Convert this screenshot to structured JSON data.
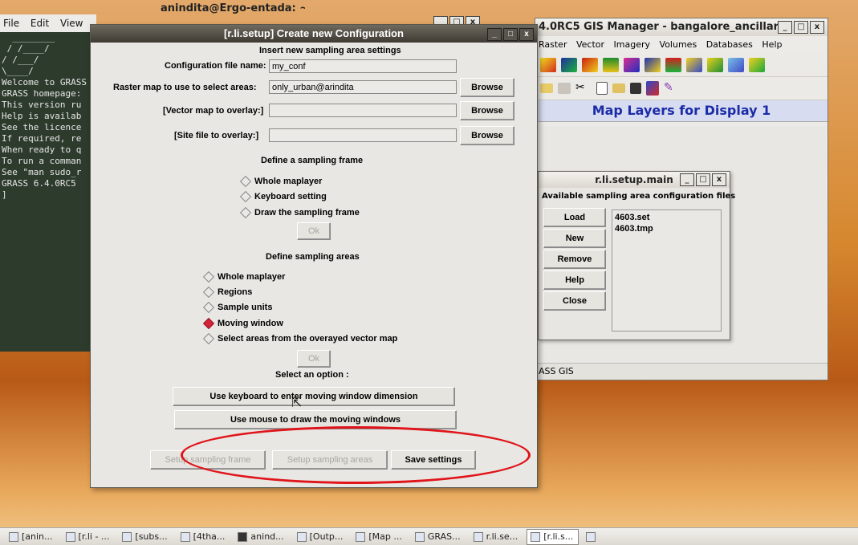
{
  "terminal": {
    "title": "anindita@Ergo-entada: ~",
    "menu": [
      "File",
      "Edit",
      "View"
    ],
    "lines": [
      "  ________",
      " / /____/",
      "/ /___/",
      "\\____/",
      "",
      "Welcome to GRASS",
      "GRASS homepage:",
      "This version ru",
      "Help is availab",
      "See the licence",
      "If required, re",
      "When ready to q",
      "",
      "To run a comman",
      "See \"man sudo_r",
      "",
      "GRASS 6.4.0RC5",
      "]"
    ]
  },
  "gis": {
    "title": "4.0RC5 GIS Manager - bangalore_ancillar",
    "menu": [
      "Raster",
      "Vector",
      "Imagery",
      "Volumes",
      "Databases",
      "Help"
    ],
    "map_layers": "Map Layers for Display 1",
    "status": "ASS GIS"
  },
  "setup_main": {
    "title": "r.li.setup.main",
    "header": "Available sampling area configuration files",
    "buttons": [
      "Load",
      "New",
      "Remove",
      "Help",
      "Close"
    ],
    "files": [
      "4603.set",
      "4603.tmp"
    ]
  },
  "dialog": {
    "title": "[r.li.setup] Create new Configuration",
    "section_title": "Insert new sampling area settings",
    "config_label": "Configuration file name:",
    "config_value": "my_conf",
    "raster_label": "Raster map to use to select areas:",
    "raster_value": "only_urban@arindita",
    "vector_label": "[Vector map to overlay:]",
    "site_label": "[Site file to overlay:]",
    "browse": "Browse",
    "frame_title": "Define a sampling frame",
    "frame_options": [
      "Whole maplayer",
      "Keyboard setting",
      "Draw the sampling frame"
    ],
    "ok": "Ok",
    "areas_title": "Define sampling areas",
    "area_options": [
      "Whole maplayer",
      "Regions",
      "Sample units",
      "Moving window",
      "Select areas from the overayed vector map"
    ],
    "select_option": "Select an option :",
    "use_keyboard": "Use keyboard to enter moving window dimension",
    "use_mouse": "Use mouse to draw the moving windows",
    "setup_frame": "Setup sampling frame",
    "setup_areas": "Setup sampling areas",
    "save": "Save settings"
  },
  "taskbar": [
    "[anin...",
    "[r.li - ...",
    "[subs...",
    "[4tha...",
    "anind...",
    "[Outp...",
    "[Map ...",
    "GRAS...",
    "r.li.se...",
    "[r.li.s...",
    ""
  ],
  "colors": {
    "accent_red": "#e0141a",
    "title_blue": "#1b2ca8"
  }
}
